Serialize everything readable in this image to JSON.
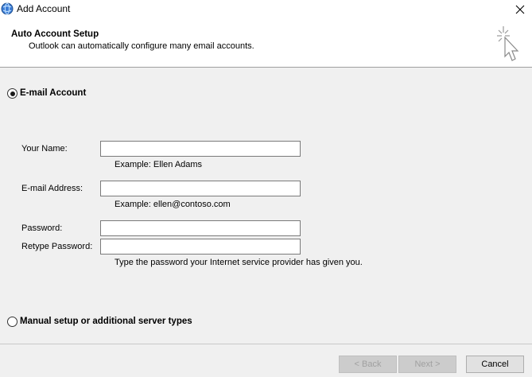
{
  "window": {
    "title": "Add Account",
    "close_label": "✕"
  },
  "header": {
    "title": "Auto Account Setup",
    "subtitle": "Outlook can automatically configure many email accounts."
  },
  "options": {
    "email_account": {
      "label": "E-mail Account",
      "selected": true
    },
    "manual_setup": {
      "label": "Manual setup or additional server types",
      "selected": false
    }
  },
  "form": {
    "name": {
      "label": "Your Name:",
      "value": "",
      "hint": "Example: Ellen Adams"
    },
    "email": {
      "label": "E-mail Address:",
      "value": "",
      "hint": "Example: ellen@contoso.com"
    },
    "password": {
      "label": "Password:",
      "value": ""
    },
    "retype_password": {
      "label": "Retype Password:",
      "value": ""
    },
    "password_hint": "Type the password your Internet service provider has given you."
  },
  "buttons": {
    "back": {
      "label": "< Back",
      "enabled": false
    },
    "next": {
      "label": "Next >",
      "enabled": false
    },
    "cancel": {
      "label": "Cancel",
      "enabled": true
    }
  },
  "icons": {
    "app": "outlook-globe-icon",
    "wizard": "magic-wand-cursor-icon",
    "close": "close-icon"
  }
}
